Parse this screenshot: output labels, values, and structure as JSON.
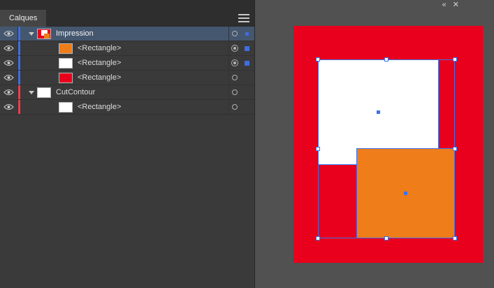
{
  "panel": {
    "tab_label": "Calques",
    "rows": [
      {
        "label": "Impression",
        "type": "layer",
        "visible": true,
        "expanded": true,
        "layer_color": "#3f6fe0",
        "selected": true,
        "targeted": false,
        "selection_indicator": "small"
      },
      {
        "label": "<Rectangle>",
        "type": "object",
        "visible": true,
        "layer_color": "#3f6fe0",
        "thumb_color": "#ee7d1a",
        "selected": false,
        "targeted": true,
        "selection_indicator": "normal"
      },
      {
        "label": "<Rectangle>",
        "type": "object",
        "visible": true,
        "layer_color": "#3f6fe0",
        "thumb_color": "#ffffff",
        "selected": false,
        "targeted": true,
        "selection_indicator": "normal"
      },
      {
        "label": "<Rectangle>",
        "type": "object",
        "visible": true,
        "layer_color": "#3f6fe0",
        "thumb_color": "#e8001c",
        "selected": false,
        "targeted": false,
        "selection_indicator": "none"
      },
      {
        "label": "CutContour",
        "type": "layer",
        "visible": true,
        "expanded": true,
        "layer_color": "#ee3d4f",
        "thumb_color": "#ffffff",
        "selected": false,
        "targeted": false,
        "selection_indicator": "none"
      },
      {
        "label": "<Rectangle>",
        "type": "object",
        "visible": true,
        "layer_color": "#ee3d4f",
        "thumb_color": "#ffffff",
        "selected": false,
        "targeted": false,
        "selection_indicator": "none"
      }
    ]
  },
  "window_controls": {
    "collapse": "«",
    "close": "✕"
  },
  "canvas": {
    "selection_color": "#3a72ef",
    "background": "#515151",
    "shapes": [
      {
        "name": "red-rectangle",
        "fill": "#e8001c",
        "selected": false
      },
      {
        "name": "white-rectangle",
        "fill": "#ffffff",
        "selected": true
      },
      {
        "name": "orange-rectangle",
        "fill": "#ee7d1a",
        "selected": true
      }
    ]
  }
}
